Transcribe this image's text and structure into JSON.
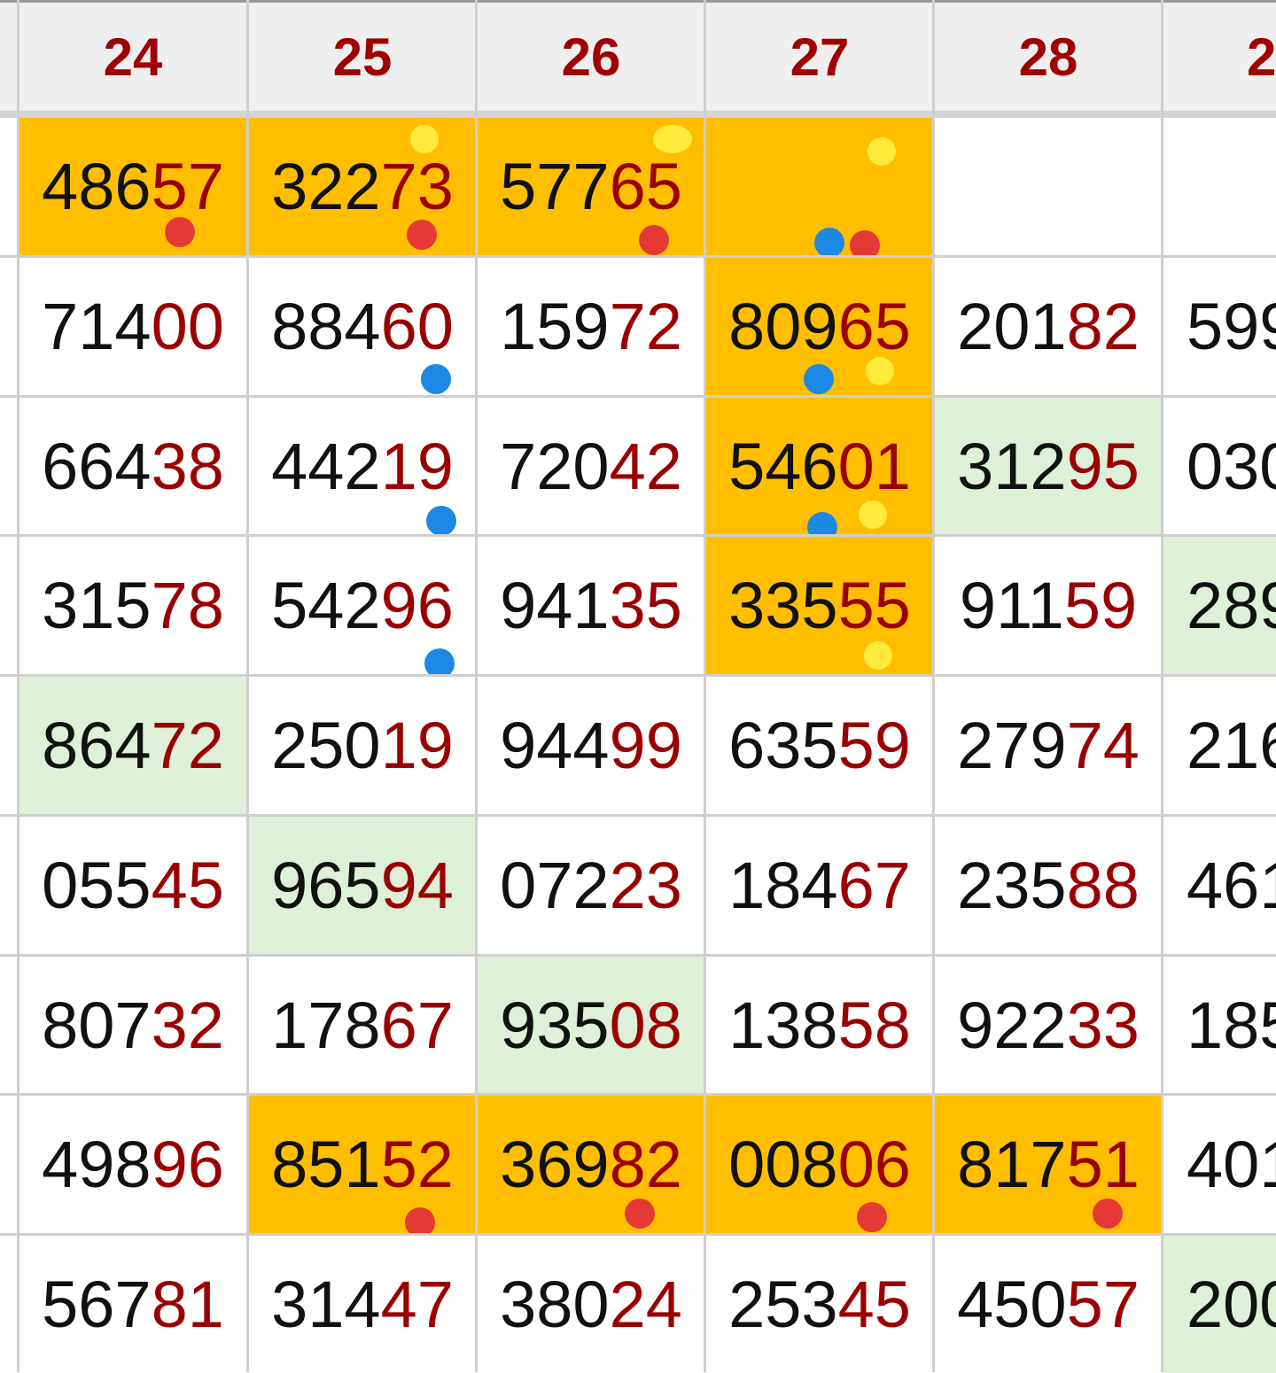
{
  "columns": [
    "24",
    "25",
    "26",
    "27",
    "28",
    "2"
  ],
  "colors": {
    "orange_highlight": "#ffbf00",
    "green_highlight": "#dff0d8",
    "day_label": "#a00000",
    "tail_digits": "#9b0000",
    "dot_red": "#e53935",
    "dot_blue": "#1e88e5",
    "dot_yellow": "#ffeb3b"
  },
  "rows": [
    [
      {
        "head": "486",
        "tail": "57",
        "bg": "orange",
        "dots": [
          {
            "color": "red"
          }
        ]
      },
      {
        "head": "322",
        "tail": "73",
        "bg": "orange",
        "dots": [
          {
            "color": "yellow"
          },
          {
            "color": "red"
          }
        ]
      },
      {
        "head": "577",
        "tail": "65",
        "bg": "orange",
        "dots": [
          {
            "color": "yellow"
          },
          {
            "color": "red"
          }
        ]
      },
      {
        "head": "",
        "tail": "",
        "bg": "orange",
        "dots": [
          {
            "color": "yellow"
          },
          {
            "color": "blue"
          },
          {
            "color": "red"
          }
        ]
      },
      {
        "head": "",
        "tail": "",
        "bg": "white",
        "dots": []
      },
      {
        "head": "",
        "tail": "",
        "bg": "white",
        "dots": []
      }
    ],
    [
      {
        "head": "714",
        "tail": "00",
        "bg": "white",
        "dots": []
      },
      {
        "head": "884",
        "tail": "60",
        "bg": "white",
        "dots": [
          {
            "color": "blue"
          }
        ]
      },
      {
        "head": "159",
        "tail": "72",
        "bg": "white",
        "dots": []
      },
      {
        "head": "809",
        "tail": "65",
        "bg": "orange",
        "dots": [
          {
            "color": "blue"
          },
          {
            "color": "yellow"
          }
        ]
      },
      {
        "head": "201",
        "tail": "82",
        "bg": "white",
        "dots": []
      },
      {
        "head": "599",
        "tail": "",
        "bg": "white",
        "dots": []
      }
    ],
    [
      {
        "head": "664",
        "tail": "38",
        "bg": "white",
        "dots": []
      },
      {
        "head": "442",
        "tail": "19",
        "bg": "white",
        "dots": [
          {
            "color": "blue"
          }
        ]
      },
      {
        "head": "720",
        "tail": "42",
        "bg": "white",
        "dots": []
      },
      {
        "head": "546",
        "tail": "01",
        "bg": "orange",
        "dots": [
          {
            "color": "blue"
          },
          {
            "color": "yellow"
          }
        ]
      },
      {
        "head": "312",
        "tail": "95",
        "bg": "green",
        "dots": []
      },
      {
        "head": "030",
        "tail": "",
        "bg": "white",
        "dots": []
      }
    ],
    [
      {
        "head": "315",
        "tail": "78",
        "bg": "white",
        "dots": []
      },
      {
        "head": "542",
        "tail": "96",
        "bg": "white",
        "dots": [
          {
            "color": "blue"
          }
        ]
      },
      {
        "head": "941",
        "tail": "35",
        "bg": "white",
        "dots": []
      },
      {
        "head": "335",
        "tail": "55",
        "bg": "orange",
        "dots": [
          {
            "color": "yellow"
          }
        ]
      },
      {
        "head": "911",
        "tail": "59",
        "bg": "white",
        "dots": []
      },
      {
        "head": "289",
        "tail": "",
        "bg": "green",
        "dots": []
      }
    ],
    [
      {
        "head": "864",
        "tail": "72",
        "bg": "green",
        "dots": []
      },
      {
        "head": "250",
        "tail": "19",
        "bg": "white",
        "dots": []
      },
      {
        "head": "944",
        "tail": "99",
        "bg": "white",
        "dots": []
      },
      {
        "head": "635",
        "tail": "59",
        "bg": "white",
        "dots": []
      },
      {
        "head": "279",
        "tail": "74",
        "bg": "white",
        "dots": []
      },
      {
        "head": "216",
        "tail": "",
        "bg": "white",
        "dots": []
      }
    ],
    [
      {
        "head": "055",
        "tail": "45",
        "bg": "white",
        "dots": []
      },
      {
        "head": "965",
        "tail": "94",
        "bg": "green",
        "dots": []
      },
      {
        "head": "072",
        "tail": "23",
        "bg": "white",
        "dots": []
      },
      {
        "head": "184",
        "tail": "67",
        "bg": "white",
        "dots": []
      },
      {
        "head": "235",
        "tail": "88",
        "bg": "white",
        "dots": []
      },
      {
        "head": "461",
        "tail": "",
        "bg": "white",
        "dots": []
      }
    ],
    [
      {
        "head": "807",
        "tail": "32",
        "bg": "white",
        "dots": []
      },
      {
        "head": "178",
        "tail": "67",
        "bg": "white",
        "dots": []
      },
      {
        "head": "935",
        "tail": "08",
        "bg": "green",
        "dots": []
      },
      {
        "head": "138",
        "tail": "58",
        "bg": "white",
        "dots": []
      },
      {
        "head": "922",
        "tail": "33",
        "bg": "white",
        "dots": []
      },
      {
        "head": "185",
        "tail": "",
        "bg": "white",
        "dots": []
      }
    ],
    [
      {
        "head": "498",
        "tail": "96",
        "bg": "white",
        "dots": []
      },
      {
        "head": "851",
        "tail": "52",
        "bg": "orange",
        "dots": [
          {
            "color": "red"
          }
        ]
      },
      {
        "head": "369",
        "tail": "82",
        "bg": "orange",
        "dots": [
          {
            "color": "red"
          }
        ]
      },
      {
        "head": "008",
        "tail": "06",
        "bg": "orange",
        "dots": [
          {
            "color": "red"
          }
        ]
      },
      {
        "head": "817",
        "tail": "51",
        "bg": "orange",
        "dots": [
          {
            "color": "red"
          }
        ]
      },
      {
        "head": "401",
        "tail": "",
        "bg": "white",
        "dots": []
      }
    ],
    [
      {
        "head": "567",
        "tail": "81",
        "bg": "white",
        "dots": []
      },
      {
        "head": "314",
        "tail": "47",
        "bg": "white",
        "dots": []
      },
      {
        "head": "380",
        "tail": "24",
        "bg": "white",
        "dots": []
      },
      {
        "head": "253",
        "tail": "45",
        "bg": "white",
        "dots": []
      },
      {
        "head": "450",
        "tail": "57",
        "bg": "white",
        "dots": []
      },
      {
        "head": "200",
        "tail": "",
        "bg": "green",
        "dots": []
      }
    ]
  ]
}
